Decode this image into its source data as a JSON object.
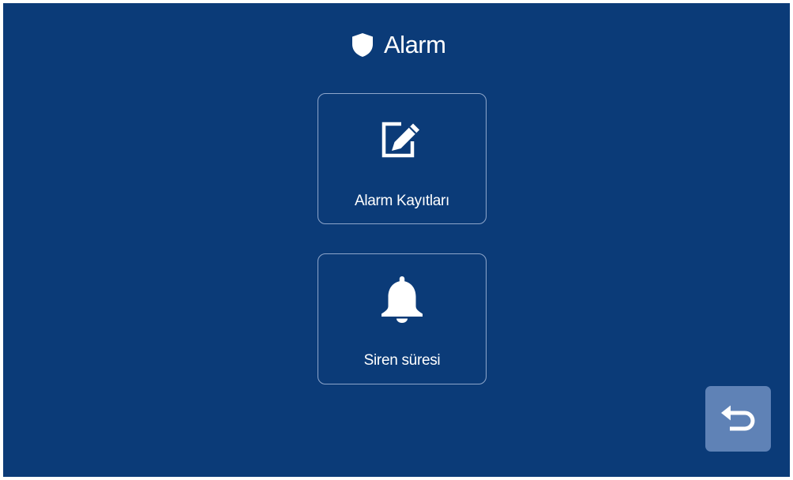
{
  "header": {
    "title": "Alarm",
    "icon": "shield-icon"
  },
  "menu": {
    "items": [
      {
        "label": "Alarm Kayıtları",
        "icon": "edit-icon"
      },
      {
        "label": "Siren süresi",
        "icon": "bell-icon"
      }
    ]
  },
  "footer": {
    "back_icon": "back-arrow-icon"
  },
  "colors": {
    "background": "#0b3b78",
    "button_border": "#8ea6cb",
    "back_button": "#5f82b6",
    "text": "#ffffff"
  }
}
